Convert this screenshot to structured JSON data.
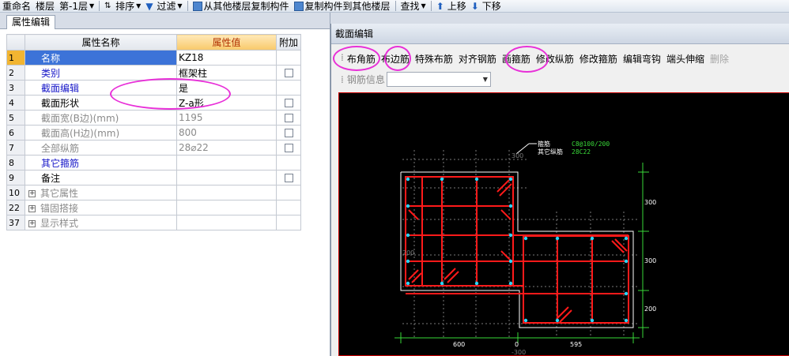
{
  "toolbar": {
    "rename": "重命名",
    "floor_label": "楼层",
    "floor_value": "第-1层",
    "sort": "排序",
    "filter": "过滤",
    "copy_from": "从其他楼层复制构件",
    "copy_to": "复制构件到其他楼层",
    "find": "查找",
    "move_up": "上移",
    "move_down": "下移"
  },
  "props": {
    "tab": "属性编辑",
    "col_name": "属性名称",
    "col_value": "属性值",
    "col_attach": "附加",
    "rows": [
      {
        "num": "1",
        "name": "名称",
        "value": "KZ18"
      },
      {
        "num": "2",
        "name": "类别",
        "value": "框架柱"
      },
      {
        "num": "3",
        "name": "截面编辑",
        "value": "是"
      },
      {
        "num": "4",
        "name": "截面形状",
        "value": "Z-a形"
      },
      {
        "num": "5",
        "name": "截面宽(B边)(mm)",
        "value": "1195"
      },
      {
        "num": "6",
        "name": "截面高(H边)(mm)",
        "value": "800"
      },
      {
        "num": "7",
        "name": "全部纵筋",
        "value": "28⌀22"
      },
      {
        "num": "8",
        "name": "其它箍筋",
        "value": ""
      },
      {
        "num": "9",
        "name": "备注",
        "value": ""
      },
      {
        "num": "10",
        "name": "其它属性",
        "value": ""
      },
      {
        "num": "22",
        "name": "锚固搭接",
        "value": ""
      },
      {
        "num": "37",
        "name": "显示样式",
        "value": ""
      }
    ]
  },
  "editor": {
    "title": "截面编辑",
    "tools": [
      "布角筋",
      "布边筋",
      "特殊布筋",
      "对齐钢筋",
      "画箍筋",
      "修改纵筋",
      "修改箍筋",
      "编辑弯钩",
      "端头伸缩",
      "删除"
    ],
    "rebar_info_label": "钢筋信息",
    "rebar_info_value": ""
  },
  "drawing": {
    "labels": {
      "stirrup": "箍筋",
      "other_long": "其它纵筋",
      "stirrup_val": "C8@100/200",
      "long_val": "28C22",
      "top_300": "300",
      "left_200": "200"
    },
    "dims": {
      "right_1": "300",
      "right_2": "300",
      "right_3": "200",
      "bottom_1": "600",
      "bottom_2": "595",
      "bottom_0": "0",
      "bottom_neg": "-300"
    }
  }
}
